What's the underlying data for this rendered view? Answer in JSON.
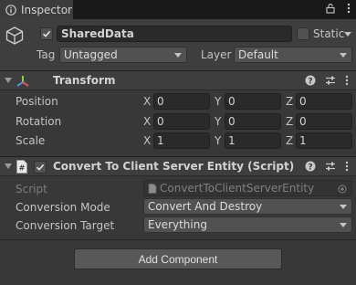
{
  "tab": {
    "title": "Inspector",
    "icon": "info-icon"
  },
  "tabbar_icons": [
    "lock-icon",
    "kebab-menu-icon"
  ],
  "gameobject": {
    "icon": "cube-icon",
    "active": true,
    "name": "SharedData",
    "static_label": "Static",
    "static_checked": false,
    "tag_label": "Tag",
    "tag_value": "Untagged",
    "layer_label": "Layer",
    "layer_value": "Default"
  },
  "transform": {
    "title": "Transform",
    "icon": "transform-axes-icon",
    "rows": [
      {
        "label": "Position",
        "x": "0",
        "y": "0",
        "z": "0"
      },
      {
        "label": "Rotation",
        "x": "0",
        "y": "0",
        "z": "0"
      },
      {
        "label": "Scale",
        "x": "1",
        "y": "1",
        "z": "1"
      }
    ],
    "axis_labels": {
      "x": "X",
      "y": "Y",
      "z": "Z"
    }
  },
  "script_component": {
    "enabled": true,
    "icon": "script-file-icon",
    "title": "Convert To Client Server Entity (Script)",
    "script_label": "Script",
    "script_value": "ConvertToClientServerEntity",
    "mode_label": "Conversion Mode",
    "mode_value": "Convert And Destroy",
    "target_label": "Conversion Target",
    "target_value": "Everything"
  },
  "component_header_icons": [
    "help-icon",
    "preset-sliders-icon",
    "kebab-menu-icon"
  ],
  "add_component_label": "Add Component",
  "colors": {
    "window_bg": "#383838",
    "header_bg": "#3e3e3e",
    "field_bg": "#2a2a2a",
    "transform_icon_x": "#e0524f",
    "transform_icon_y": "#8ed14a",
    "transform_icon_z": "#4e8ef0"
  }
}
